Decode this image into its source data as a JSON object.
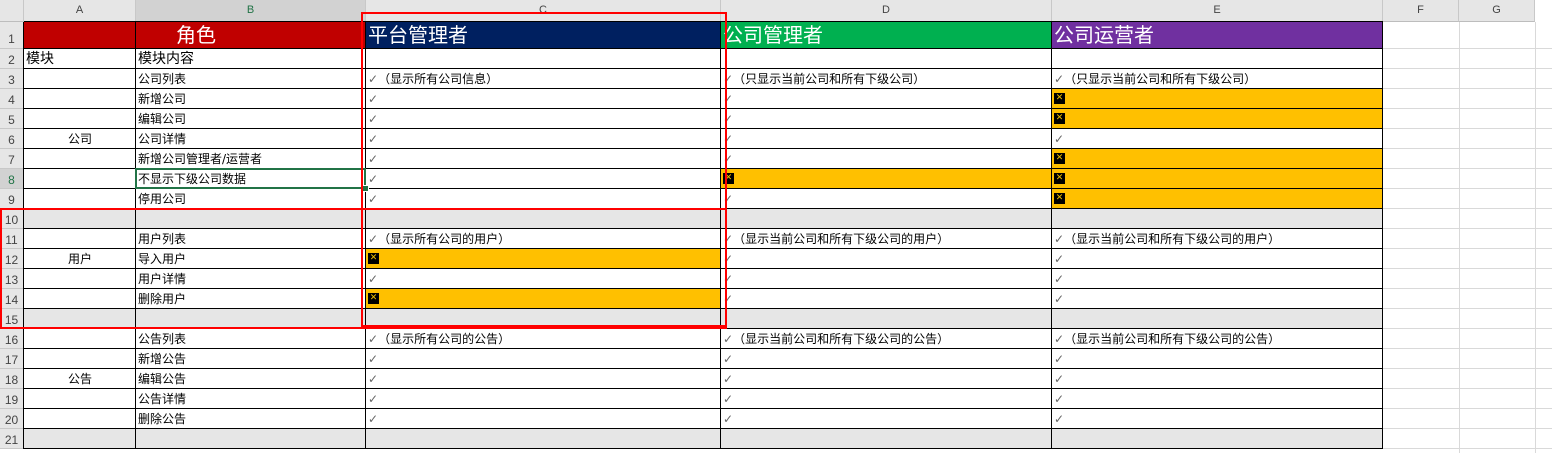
{
  "columns": [
    "A",
    "B",
    "C",
    "D",
    "E",
    "F",
    "G"
  ],
  "colors": {
    "role_header_bg": "#c00000",
    "platform_admin_bg": "#002060",
    "company_admin_bg": "#00b050",
    "company_operator_bg": "#7030a0",
    "denied_bg": "#ffc000",
    "blank_row_bg": "#e6e6e6",
    "highlight_box": "#ff0000",
    "selected_cell_border": "#217346"
  },
  "header": {
    "role": "角色",
    "platform_admin": "平台管理者",
    "company_admin": "公司管理者",
    "company_operator": "公司运营者"
  },
  "sub_header": {
    "module": "模块",
    "content": "模块内容"
  },
  "check_symbol": "✓",
  "deny_symbol": "✕",
  "rows": [
    {
      "row": "3",
      "module": "",
      "content": "公司列表",
      "c": "（显示所有公司信息）",
      "d": "（只显示当前公司和所有下级公司）",
      "e": "（只显示当前公司和所有下级公司）",
      "c_deny": false,
      "d_deny": false,
      "e_deny": false
    },
    {
      "row": "4",
      "module": "",
      "content": "新增公司",
      "c": "",
      "d": "",
      "e": "",
      "c_deny": false,
      "d_deny": false,
      "e_deny": true
    },
    {
      "row": "5",
      "module": "",
      "content": "编辑公司",
      "c": "",
      "d": "",
      "e": "",
      "c_deny": false,
      "d_deny": false,
      "e_deny": true
    },
    {
      "row": "6",
      "module": "公司",
      "content": "公司详情",
      "c": "",
      "d": "",
      "e": "",
      "c_deny": false,
      "d_deny": false,
      "e_deny": false
    },
    {
      "row": "7",
      "module": "",
      "content": "新增公司管理者/运营者",
      "c": "",
      "d": "",
      "e": "",
      "c_deny": false,
      "d_deny": false,
      "e_deny": true
    },
    {
      "row": "8",
      "module": "",
      "content": "不显示下级公司数据",
      "c": "",
      "d": "",
      "e": "",
      "c_deny": false,
      "d_deny": true,
      "e_deny": true
    },
    {
      "row": "9",
      "module": "",
      "content": "停用公司",
      "c": "",
      "d": "",
      "e": "",
      "c_deny": false,
      "d_deny": false,
      "e_deny": true
    },
    {
      "row": "10",
      "blank": true
    },
    {
      "row": "11",
      "module": "",
      "content": "用户列表",
      "c": "（显示所有公司的用户）",
      "d": "（显示当前公司和所有下级公司的用户）",
      "e": "（显示当前公司和所有下级公司的用户）",
      "c_deny": false,
      "d_deny": false,
      "e_deny": false
    },
    {
      "row": "12",
      "module": "用户",
      "content": "导入用户",
      "c": "",
      "d": "",
      "e": "",
      "c_deny": true,
      "d_deny": false,
      "e_deny": false
    },
    {
      "row": "13",
      "module": "",
      "content": "用户详情",
      "c": "",
      "d": "",
      "e": "",
      "c_deny": false,
      "d_deny": false,
      "e_deny": false
    },
    {
      "row": "14",
      "module": "",
      "content": "删除用户",
      "c": "",
      "d": "",
      "e": "",
      "c_deny": true,
      "d_deny": false,
      "e_deny": false
    },
    {
      "row": "15",
      "blank": true
    },
    {
      "row": "16",
      "module": "",
      "content": "公告列表",
      "c": "（显示所有公司的公告）",
      "d": "（显示当前公司和所有下级公司的公告）",
      "e": "（显示当前公司和所有下级公司的公告）",
      "c_deny": false,
      "d_deny": false,
      "e_deny": false
    },
    {
      "row": "17",
      "module": "",
      "content": "新增公告",
      "c": "",
      "d": "",
      "e": "",
      "c_deny": false,
      "d_deny": false,
      "e_deny": false
    },
    {
      "row": "18",
      "module": "公告",
      "content": "编辑公告",
      "c": "",
      "d": "",
      "e": "",
      "c_deny": false,
      "d_deny": false,
      "e_deny": false
    },
    {
      "row": "19",
      "module": "",
      "content": "公告详情",
      "c": "",
      "d": "",
      "e": "",
      "c_deny": false,
      "d_deny": false,
      "e_deny": false
    },
    {
      "row": "20",
      "module": "",
      "content": "删除公告",
      "c": "",
      "d": "",
      "e": "",
      "c_deny": false,
      "d_deny": false,
      "e_deny": false
    },
    {
      "row": "21",
      "blank": true
    }
  ]
}
